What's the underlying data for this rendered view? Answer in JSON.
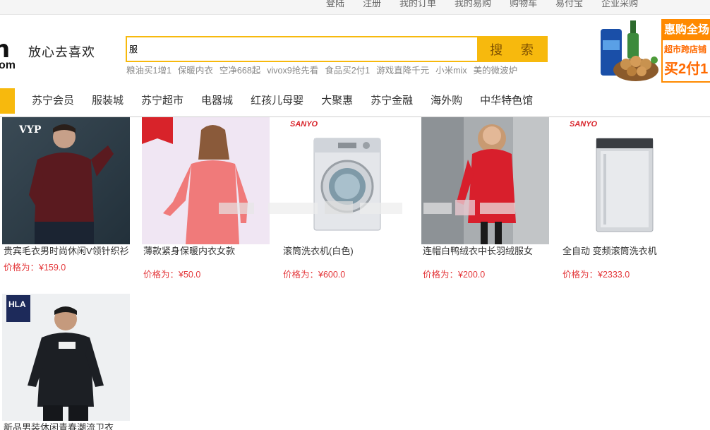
{
  "topbar": {
    "links": [
      "登陆",
      "注册",
      "我的订单",
      "我的易购",
      "购物车",
      "易付宝",
      "企业采购"
    ]
  },
  "header": {
    "logo_mark": "n",
    "logo_sub": "om",
    "slogan": "放心去喜欢"
  },
  "search": {
    "value": "服",
    "button_label": "搜 索",
    "hotwords": [
      "粮油买1增1",
      "保暖内衣",
      "空净668起",
      "vivox9抢先看",
      "食品买2付1",
      "游戏直降千元",
      "小米mix",
      "美的微波炉"
    ]
  },
  "promo": {
    "title": "惠购全场",
    "line2": "超市跨店铺",
    "line3": "买2付1"
  },
  "nav": {
    "items": [
      "苏宁会员",
      "服装城",
      "苏宁超市",
      "电器城",
      "红孩儿母婴",
      "大聚惠",
      "苏宁金融",
      "海外购",
      "中华特色馆"
    ]
  },
  "products": [
    {
      "name": "贵宾毛衣男时尚休闲V领针织衫",
      "price": "价格为：¥159.0",
      "brand": "VYP"
    },
    {
      "name": "薄款紧身保暖内衣女款",
      "price": "价格为：¥50.0",
      "brand": ""
    },
    {
      "name": "滚筒洗衣机(白色)",
      "price": "价格为：¥600.0",
      "brand": "SANYO"
    },
    {
      "name": "连帽白鸭绒衣中长羽绒服女",
      "price": "价格为：¥200.0",
      "brand": ""
    },
    {
      "name": "全自动 变频滚筒洗衣机",
      "price": "价格为：¥2333.0",
      "brand": "SANYO"
    },
    {
      "name": "新品男装休闲青春潮流卫衣",
      "price": "",
      "brand": "HLA"
    }
  ],
  "colors": {
    "accent": "#f7b90d",
    "price": "#e4393c",
    "promo": "#ff8a00"
  }
}
